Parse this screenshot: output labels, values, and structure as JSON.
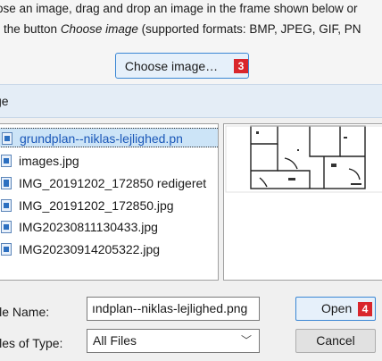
{
  "instructions": {
    "line1": "ose an image, drag and drop an image in the frame shown below or",
    "line2_pre": " the button ",
    "line2_em": "Choose image",
    "line2_post": " (supported formats: BMP, JPEG, GIF, PN"
  },
  "choose_button": {
    "label": "Choose image…",
    "badge": "3"
  },
  "dialog": {
    "title": "ge"
  },
  "files": [
    {
      "name": "grundplan--niklas-lejlighed.pn",
      "selected": true
    },
    {
      "name": "images.jpg",
      "selected": false
    },
    {
      "name": "IMG_20191202_172850 redigeret",
      "selected": false
    },
    {
      "name": "IMG_20191202_172850.jpg",
      "selected": false
    },
    {
      "name": "IMG20230811130433.jpg",
      "selected": false
    },
    {
      "name": "IMG20230914205322.jpg",
      "selected": false
    }
  ],
  "file_name": {
    "label": "ile Name:",
    "value": "ındplan--niklas-lejlighed.png"
  },
  "file_type": {
    "label": "iles of Type:",
    "value": "All Files"
  },
  "open_button": {
    "label": "Open",
    "badge": "4"
  },
  "cancel_button": {
    "label": "Cancel"
  },
  "icons": {
    "file": "image-file-icon",
    "dropdown": "chevron-down-icon"
  }
}
